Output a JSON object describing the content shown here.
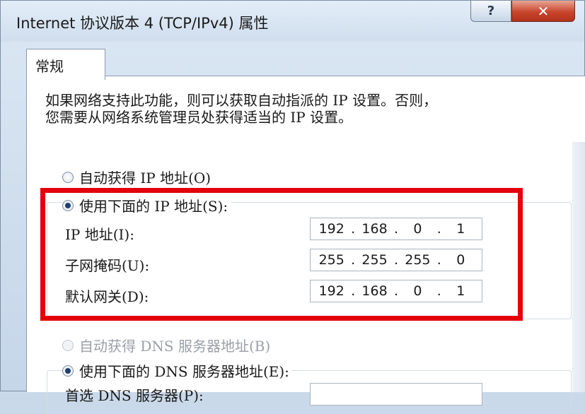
{
  "window": {
    "title": "Internet 协议版本 4 (TCP/IPv4) 属性",
    "help_glyph": "?",
    "close_glyph": "✕"
  },
  "tabs": [
    {
      "label": "常规"
    }
  ],
  "description_line1": "如果网络支持此功能，则可以获取自动指派的 IP 设置。否则，",
  "description_line2": "您需要从网络系统管理员处获得适当的 IP 设置。",
  "ip": {
    "auto_label": "自动获得 IP 地址(O)",
    "manual_label": "使用下面的 IP 地址(S):",
    "fields": [
      {
        "label": "IP 地址(I):",
        "octets": [
          "192",
          "168",
          "0",
          "1"
        ]
      },
      {
        "label": "子网掩码(U):",
        "octets": [
          "255",
          "255",
          "255",
          "0"
        ]
      },
      {
        "label": "默认网关(D):",
        "octets": [
          "192",
          "168",
          "0",
          "1"
        ]
      }
    ]
  },
  "dns": {
    "auto_label": "自动获得 DNS 服务器地址(B)",
    "manual_label": "使用下面的 DNS 服务器地址(E):",
    "preferred_label": "首选 DNS 服务器(P):"
  },
  "colors": {
    "highlight": "#e3000b",
    "close": "#c9452c"
  }
}
